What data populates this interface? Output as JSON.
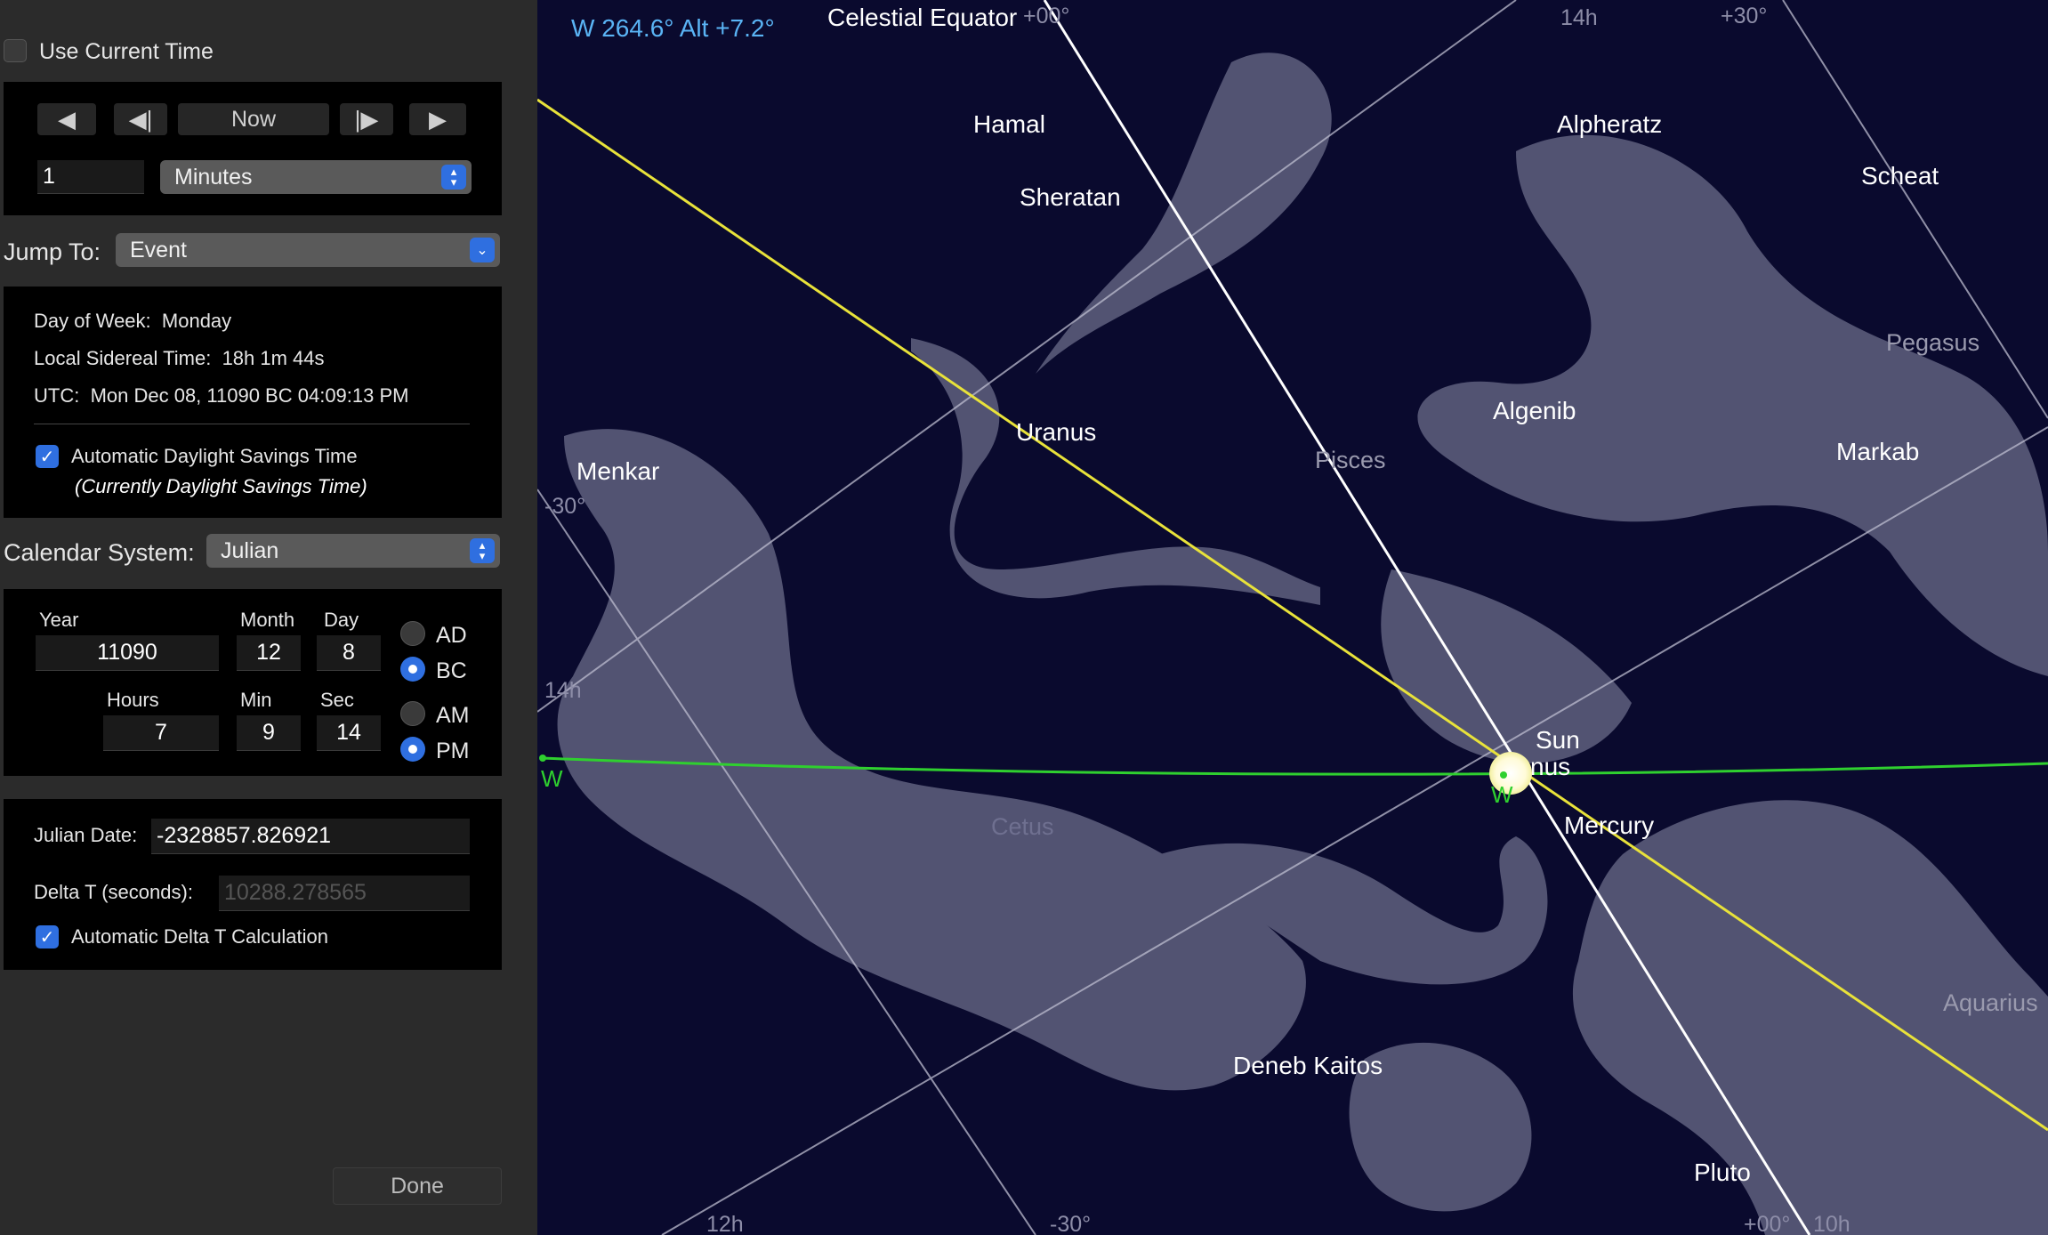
{
  "panel": {
    "use_current_time": "Use Current Time",
    "step_controls": {
      "now": "Now",
      "step_value": "1",
      "step_unit": "Minutes"
    },
    "jump_to": {
      "label": "Jump To:",
      "value": "Event"
    },
    "info": {
      "day_of_week_label": "Day of Week:",
      "day_of_week": "Monday",
      "sidereal_label": "Local Sidereal Time:",
      "sidereal": "18h 1m 44s",
      "utc_label": "UTC:",
      "utc": "Mon Dec 08, 11090 BC 04:09:13 PM",
      "dst_label": "Automatic Daylight Savings Time",
      "dst_note": "(Currently Daylight Savings Time)"
    },
    "calendar": {
      "label": "Calendar System:",
      "value": "Julian"
    },
    "date": {
      "year_label": "Year",
      "year": "11090",
      "month_label": "Month",
      "month": "12",
      "day_label": "Day",
      "day": "8",
      "hours_label": "Hours",
      "hours": "7",
      "min_label": "Min",
      "min": "9",
      "sec_label": "Sec",
      "sec": "14",
      "ad": "AD",
      "bc": "BC",
      "am": "AM",
      "pm": "PM"
    },
    "julian": {
      "jd_label": "Julian Date:",
      "jd": "-2328857.826921",
      "dt_label": "Delta T (seconds):",
      "dt": "10288.278565",
      "auto_dt_label": "Automatic Delta T Calculation"
    },
    "done": "Done"
  },
  "sky": {
    "readout": "W 264.6° Alt +7.2°",
    "celestial_equator": "Celestial Equator",
    "stars": {
      "hamal": "Hamal",
      "sheratan": "Sheratan",
      "alpheratz": "Alpheratz",
      "scheat": "Scheat",
      "algenib": "Algenib",
      "markab": "Markab",
      "menkar": "Menkar",
      "deneb_kaitos": "Deneb Kaitos"
    },
    "planets": {
      "uranus": "Uranus",
      "sun": "Sun",
      "venus_partial": "nus",
      "mercury": "Mercury",
      "pluto": "Pluto"
    },
    "constellations": {
      "pisces": "Pisces",
      "pegasus": "Pegasus",
      "cetus": "Cetus",
      "aquarius": "Aquarius"
    },
    "grid_labels": {
      "top_00": "+00°",
      "top_14h": "14h",
      "top_30": "+30°",
      "left_m30": "-30°",
      "left_14h": "14h",
      "bottom_12h": "12h",
      "bottom_m30": "-30°",
      "bottom_00": "+00°",
      "bottom_10h": "10h"
    },
    "horizon_marks": {
      "left_w": "W",
      "center_w": "W"
    },
    "colors": {
      "sky": "#0a0a2e",
      "ecliptic": "#e8e23a",
      "horizon": "#2fd02f",
      "readout": "#5ab4f5",
      "sun": "#fffbd8"
    }
  }
}
